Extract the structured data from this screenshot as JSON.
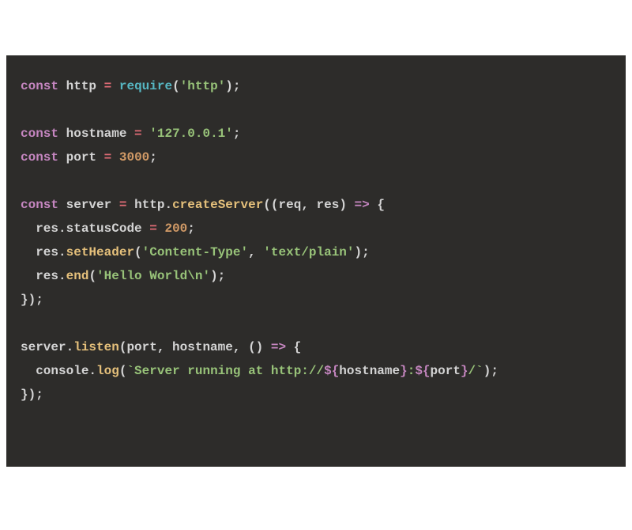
{
  "code": {
    "lines": [
      {
        "indent": 0,
        "tokens": [
          {
            "t": "keyword",
            "v": "const"
          },
          {
            "t": "space",
            "v": " "
          },
          {
            "t": "variable",
            "v": "http"
          },
          {
            "t": "space",
            "v": " "
          },
          {
            "t": "operator",
            "v": "="
          },
          {
            "t": "space",
            "v": " "
          },
          {
            "t": "function",
            "v": "require"
          },
          {
            "t": "punct",
            "v": "("
          },
          {
            "t": "string",
            "v": "'http'"
          },
          {
            "t": "punct",
            "v": ");"
          }
        ]
      },
      {
        "blank": true
      },
      {
        "indent": 0,
        "tokens": [
          {
            "t": "keyword",
            "v": "const"
          },
          {
            "t": "space",
            "v": " "
          },
          {
            "t": "variable",
            "v": "hostname"
          },
          {
            "t": "space",
            "v": " "
          },
          {
            "t": "operator",
            "v": "="
          },
          {
            "t": "space",
            "v": " "
          },
          {
            "t": "string",
            "v": "'127.0.0.1'"
          },
          {
            "t": "punct",
            "v": ";"
          }
        ]
      },
      {
        "indent": 0,
        "tokens": [
          {
            "t": "keyword",
            "v": "const"
          },
          {
            "t": "space",
            "v": " "
          },
          {
            "t": "variable",
            "v": "port"
          },
          {
            "t": "space",
            "v": " "
          },
          {
            "t": "operator",
            "v": "="
          },
          {
            "t": "space",
            "v": " "
          },
          {
            "t": "number",
            "v": "3000"
          },
          {
            "t": "punct",
            "v": ";"
          }
        ]
      },
      {
        "blank": true
      },
      {
        "indent": 0,
        "tokens": [
          {
            "t": "keyword",
            "v": "const"
          },
          {
            "t": "space",
            "v": " "
          },
          {
            "t": "variable",
            "v": "server"
          },
          {
            "t": "space",
            "v": " "
          },
          {
            "t": "operator",
            "v": "="
          },
          {
            "t": "space",
            "v": " "
          },
          {
            "t": "variable",
            "v": "http"
          },
          {
            "t": "punct",
            "v": "."
          },
          {
            "t": "function2",
            "v": "createServer"
          },
          {
            "t": "punct",
            "v": "(("
          },
          {
            "t": "param",
            "v": "req"
          },
          {
            "t": "punct",
            "v": ", "
          },
          {
            "t": "param",
            "v": "res"
          },
          {
            "t": "punct",
            "v": ") "
          },
          {
            "t": "keyword",
            "v": "=>"
          },
          {
            "t": "punct",
            "v": " {"
          }
        ]
      },
      {
        "indent": 1,
        "tokens": [
          {
            "t": "variable",
            "v": "res"
          },
          {
            "t": "punct",
            "v": "."
          },
          {
            "t": "prop",
            "v": "statusCode"
          },
          {
            "t": "space",
            "v": " "
          },
          {
            "t": "operator",
            "v": "="
          },
          {
            "t": "space",
            "v": " "
          },
          {
            "t": "number",
            "v": "200"
          },
          {
            "t": "punct",
            "v": ";"
          }
        ]
      },
      {
        "indent": 1,
        "tokens": [
          {
            "t": "variable",
            "v": "res"
          },
          {
            "t": "punct",
            "v": "."
          },
          {
            "t": "function2",
            "v": "setHeader"
          },
          {
            "t": "punct",
            "v": "("
          },
          {
            "t": "string",
            "v": "'Content-Type'"
          },
          {
            "t": "punct",
            "v": ", "
          },
          {
            "t": "string",
            "v": "'text/plain'"
          },
          {
            "t": "punct",
            "v": ");"
          }
        ]
      },
      {
        "indent": 1,
        "tokens": [
          {
            "t": "variable",
            "v": "res"
          },
          {
            "t": "punct",
            "v": "."
          },
          {
            "t": "function2",
            "v": "end"
          },
          {
            "t": "punct",
            "v": "("
          },
          {
            "t": "string",
            "v": "'Hello World\\n'"
          },
          {
            "t": "punct",
            "v": ");"
          }
        ]
      },
      {
        "indent": 0,
        "tokens": [
          {
            "t": "punct",
            "v": "});"
          }
        ]
      },
      {
        "blank": true
      },
      {
        "indent": 0,
        "tokens": [
          {
            "t": "variable",
            "v": "server"
          },
          {
            "t": "punct",
            "v": "."
          },
          {
            "t": "function2",
            "v": "listen"
          },
          {
            "t": "punct",
            "v": "("
          },
          {
            "t": "variable",
            "v": "port"
          },
          {
            "t": "punct",
            "v": ", "
          },
          {
            "t": "variable",
            "v": "hostname"
          },
          {
            "t": "punct",
            "v": ", () "
          },
          {
            "t": "keyword",
            "v": "=>"
          },
          {
            "t": "punct",
            "v": " {"
          }
        ]
      },
      {
        "indent": 1,
        "tokens": [
          {
            "t": "variable",
            "v": "console"
          },
          {
            "t": "punct",
            "v": "."
          },
          {
            "t": "function2",
            "v": "log"
          },
          {
            "t": "punct",
            "v": "("
          },
          {
            "t": "string",
            "v": "`Server running at http://"
          },
          {
            "t": "keyword",
            "v": "${"
          },
          {
            "t": "variable",
            "v": "hostname"
          },
          {
            "t": "keyword",
            "v": "}"
          },
          {
            "t": "string",
            "v": ":"
          },
          {
            "t": "keyword",
            "v": "${"
          },
          {
            "t": "variable",
            "v": "port"
          },
          {
            "t": "keyword",
            "v": "}"
          },
          {
            "t": "string",
            "v": "/`"
          },
          {
            "t": "punct",
            "v": ");"
          }
        ]
      },
      {
        "indent": 0,
        "tokens": [
          {
            "t": "punct",
            "v": "});"
          }
        ]
      }
    ]
  }
}
